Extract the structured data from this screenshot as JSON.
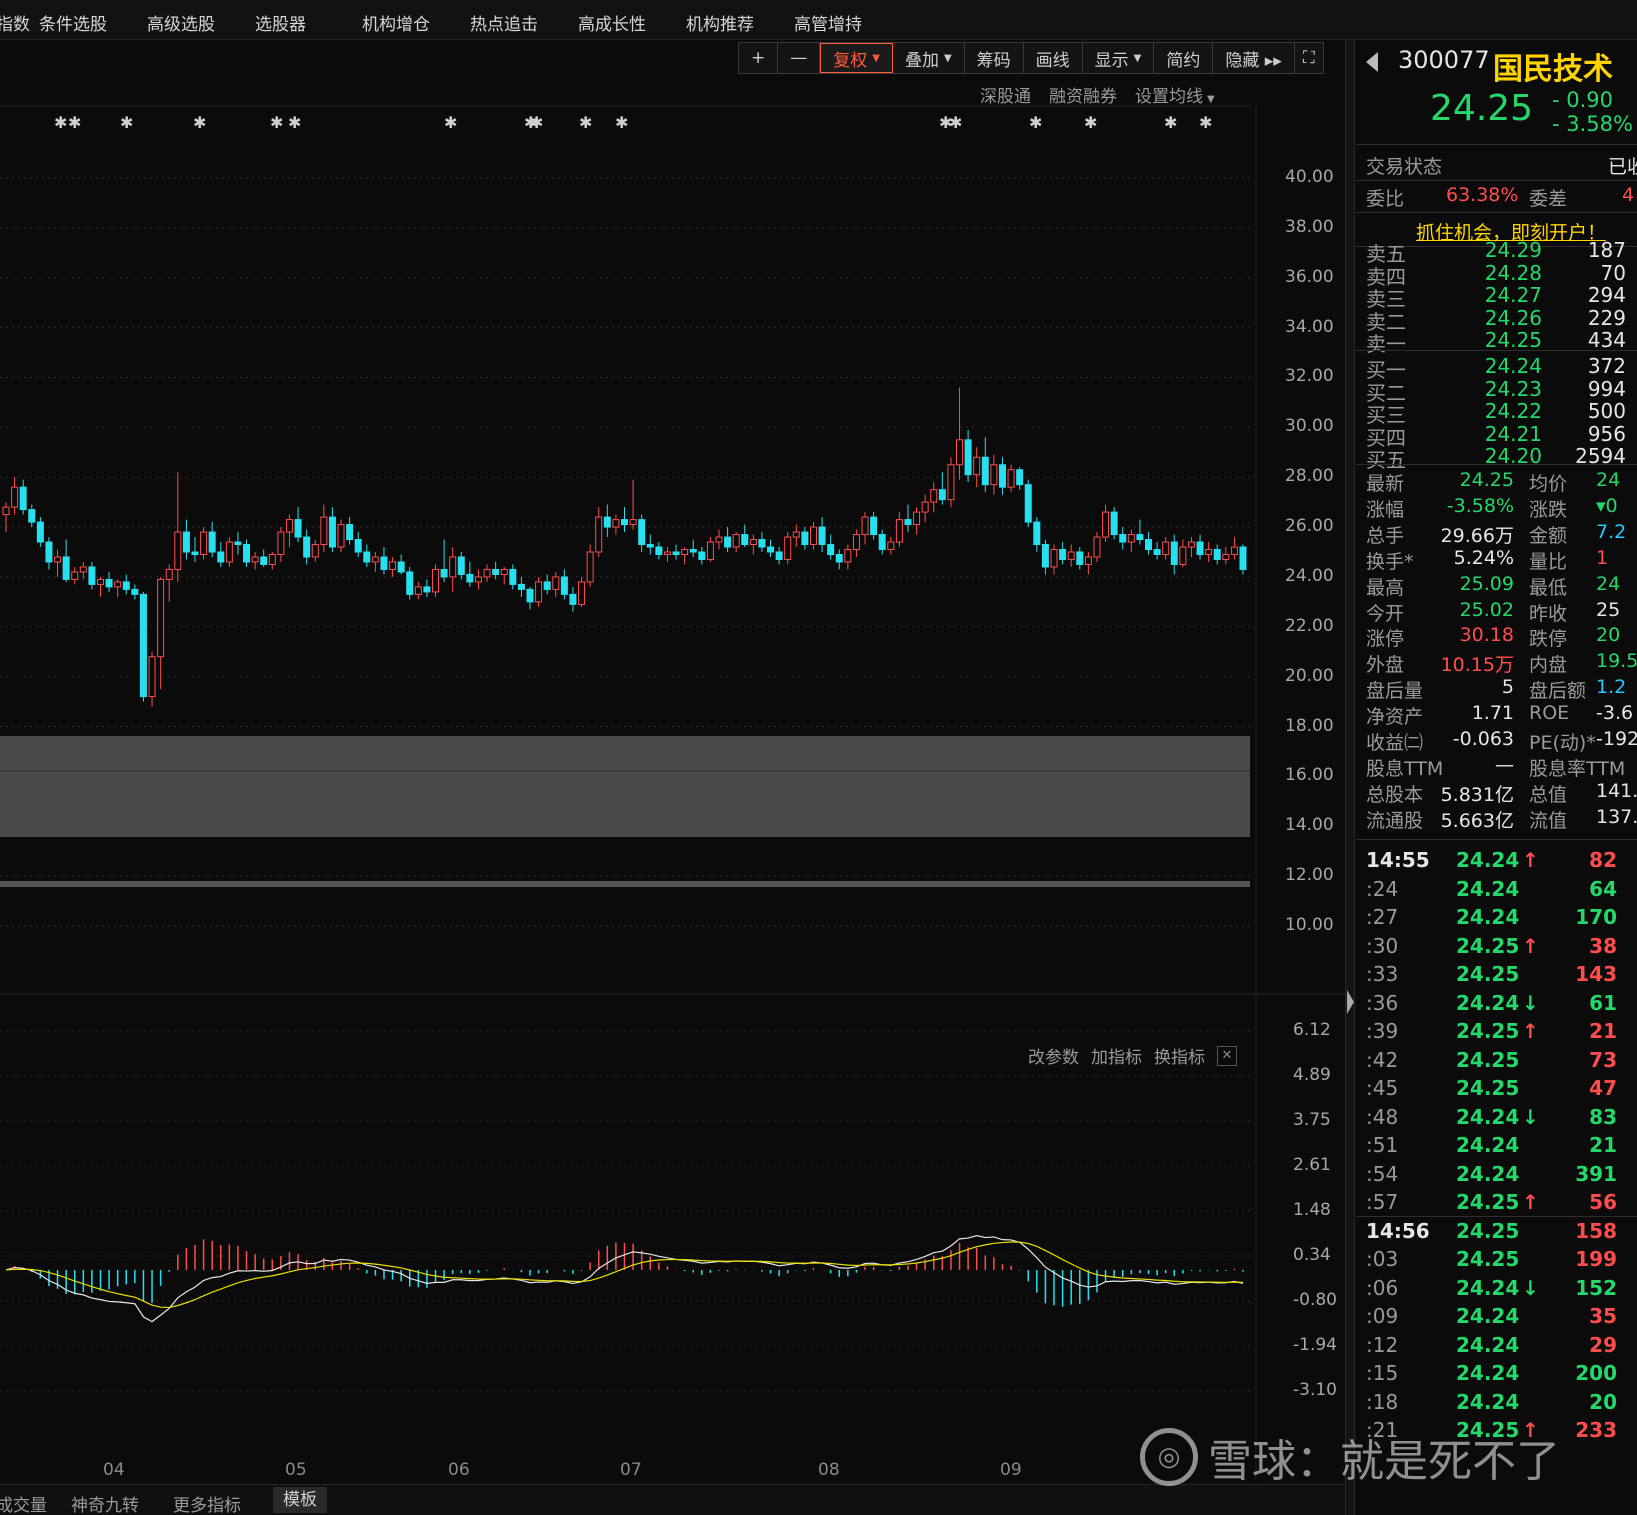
{
  "menu": [
    "指数",
    "条件选股",
    "高级选股",
    "选股器",
    "机构增仓",
    "热点追击",
    "高成长性",
    "机构推荐",
    "高管增持"
  ],
  "toolbar": {
    "plus": "+",
    "minus": "—",
    "fuquan": "复权",
    "diejia": "叠加",
    "chouma": "筹码",
    "huaxian": "画线",
    "xianshi": "显示",
    "jianyue": "简约",
    "yincang": "隐藏 ▸▸",
    "fullscreen": "⛶"
  },
  "sub_toolbar": [
    "深股通",
    "融资融券",
    "设置均线"
  ],
  "indicator_toolbar": [
    "改参数",
    "加指标",
    "换指标"
  ],
  "indicator_close": "✕",
  "bottom_tabs": [
    "成交量",
    "神奇九转",
    "更多指标",
    "模板"
  ],
  "stock": {
    "code": "300077",
    "name": "国民技术",
    "price": "24.25",
    "change": "- 0.90",
    "change_pct": "- 3.58%"
  },
  "status": {
    "label": "交易状态",
    "value": "已收"
  },
  "weibi": {
    "label": "委比",
    "value": "63.38%",
    "label2": "委差",
    "value2": "4"
  },
  "promo": "抓住机会，即刻开户！",
  "asks": [
    {
      "label": "卖五",
      "price": "24.29",
      "vol": "187"
    },
    {
      "label": "卖四",
      "price": "24.28",
      "vol": "70"
    },
    {
      "label": "卖三",
      "price": "24.27",
      "vol": "294"
    },
    {
      "label": "卖二",
      "price": "24.26",
      "vol": "229"
    },
    {
      "label": "卖一",
      "price": "24.25",
      "vol": "434"
    }
  ],
  "bids": [
    {
      "label": "买一",
      "price": "24.24",
      "vol": "372"
    },
    {
      "label": "买二",
      "price": "24.23",
      "vol": "994"
    },
    {
      "label": "买三",
      "price": "24.22",
      "vol": "500"
    },
    {
      "label": "买四",
      "price": "24.21",
      "vol": "956"
    },
    {
      "label": "买五",
      "price": "24.20",
      "vol": "2594"
    }
  ],
  "quote": [
    {
      "k1": "最新",
      "v1": "24.25",
      "c1": "g",
      "k2": "均价",
      "v2": "24",
      "c2": "g"
    },
    {
      "k1": "涨幅",
      "v1": "-3.58%",
      "c1": "g",
      "k2": "涨跌",
      "v2": "▾0",
      "c2": "g"
    },
    {
      "k1": "总手",
      "v1": "29.66万",
      "c1": "w",
      "k2": "金额",
      "v2": "7.2",
      "c2": "c"
    },
    {
      "k1": "换手*",
      "v1": "5.24%",
      "c1": "w",
      "k2": "量比",
      "v2": "1",
      "c2": "r"
    },
    {
      "k1": "最高",
      "v1": "25.09",
      "c1": "g",
      "k2": "最低",
      "v2": "24",
      "c2": "g"
    },
    {
      "k1": "今开",
      "v1": "25.02",
      "c1": "g",
      "k2": "昨收",
      "v2": "25",
      "c2": "w"
    },
    {
      "k1": "涨停",
      "v1": "30.18",
      "c1": "r",
      "k2": "跌停",
      "v2": "20",
      "c2": "g"
    },
    {
      "k1": "外盘",
      "v1": "10.15万",
      "c1": "r",
      "k2": "内盘",
      "v2": "19.5",
      "c2": "g"
    },
    {
      "k1": "盘后量",
      "v1": "5",
      "c1": "w",
      "k2": "盘后额",
      "v2": "1.2",
      "c2": "c"
    },
    {
      "k1": "净资产",
      "v1": "1.71",
      "c1": "w",
      "k2": "ROE",
      "v2": "-3.6",
      "c2": "w"
    },
    {
      "k1": "收益㈡",
      "v1": "-0.063",
      "c1": "w",
      "k2": "PE(动)*",
      "v2": "-192",
      "c2": "w"
    },
    {
      "k1": "股息TTM",
      "v1": "—",
      "c1": "w",
      "k2": "股息率TTM",
      "v2": "",
      "c2": "w"
    },
    {
      "k1": "总股本",
      "v1": "5.831亿",
      "c1": "w",
      "k2": "总值",
      "v2": "141.",
      "c2": "w"
    },
    {
      "k1": "流通股",
      "v1": "5.663亿",
      "c1": "w",
      "k2": "流值",
      "v2": "137.",
      "c2": "w"
    }
  ],
  "ticks": [
    {
      "t": "14:55",
      "p": "24.24",
      "a": "↑",
      "v": "82",
      "vc": "r",
      "b": true
    },
    {
      "t": ":24",
      "p": "24.24",
      "a": "",
      "v": "64",
      "vc": "g"
    },
    {
      "t": ":27",
      "p": "24.24",
      "a": "",
      "v": "170",
      "vc": "g"
    },
    {
      "t": ":30",
      "p": "24.25",
      "a": "↑",
      "v": "38",
      "vc": "r"
    },
    {
      "t": ":33",
      "p": "24.25",
      "a": "",
      "v": "143",
      "vc": "r"
    },
    {
      "t": ":36",
      "p": "24.24",
      "a": "↓",
      "v": "61",
      "vc": "g"
    },
    {
      "t": ":39",
      "p": "24.25",
      "a": "↑",
      "v": "21",
      "vc": "r"
    },
    {
      "t": ":42",
      "p": "24.25",
      "a": "",
      "v": "73",
      "vc": "r"
    },
    {
      "t": ":45",
      "p": "24.25",
      "a": "",
      "v": "47",
      "vc": "r"
    },
    {
      "t": ":48",
      "p": "24.24",
      "a": "↓",
      "v": "83",
      "vc": "g"
    },
    {
      "t": ":51",
      "p": "24.24",
      "a": "",
      "v": "21",
      "vc": "g"
    },
    {
      "t": ":54",
      "p": "24.24",
      "a": "",
      "v": "391",
      "vc": "g"
    },
    {
      "t": ":57",
      "p": "24.25",
      "a": "↑",
      "v": "56",
      "vc": "r"
    },
    {
      "t": "14:56",
      "p": "24.25",
      "a": "",
      "v": "158",
      "vc": "r",
      "b": true
    },
    {
      "t": ":03",
      "p": "24.25",
      "a": "",
      "v": "199",
      "vc": "r"
    },
    {
      "t": ":06",
      "p": "24.24",
      "a": "↓",
      "v": "152",
      "vc": "g"
    },
    {
      "t": ":09",
      "p": "24.24",
      "a": "",
      "v": "35",
      "vc": "r"
    },
    {
      "t": ":12",
      "p": "24.24",
      "a": "",
      "v": "29",
      "vc": "r"
    },
    {
      "t": ":15",
      "p": "24.24",
      "a": "",
      "v": "200",
      "vc": "g"
    },
    {
      "t": ":18",
      "p": "24.24",
      "a": "",
      "v": "20",
      "vc": "g"
    },
    {
      "t": ":21",
      "p": "24.25",
      "a": "↑",
      "v": "233",
      "vc": "r"
    }
  ],
  "price_axis": [
    "40.00",
    "38.00",
    "36.00",
    "34.00",
    "32.00",
    "30.00",
    "28.00",
    "26.00",
    "24.00",
    "22.00",
    "20.00",
    "18.00",
    "16.00",
    "14.00",
    "12.00",
    "10.00"
  ],
  "macd_axis": [
    "6.12",
    "4.89",
    "3.75",
    "2.61",
    "1.48",
    "0.34",
    "-0.80",
    "-1.94",
    "-3.10"
  ],
  "month_labels": [
    "04",
    "05",
    "06",
    "07",
    "08",
    "09"
  ],
  "watermark": {
    "logo": "◎",
    "text": "雪球：就是死不了"
  },
  "colors": {
    "up": "#ff4d4d",
    "down": "#27e0ef",
    "dif": "#e6e6e6",
    "dea": "#e8e000",
    "accent": "#ff5a3c"
  },
  "chart_data": {
    "type": "candlestick",
    "ylim": [
      9,
      42
    ],
    "macd_ylim": [
      -3.1,
      6.12
    ],
    "candles": [
      [
        26.5,
        27.0,
        25.8,
        26.8
      ],
      [
        26.8,
        28.0,
        26.5,
        27.6
      ],
      [
        27.6,
        27.9,
        26.5,
        26.7
      ],
      [
        26.7,
        26.9,
        26.0,
        26.2
      ],
      [
        26.2,
        26.4,
        25.2,
        25.4
      ],
      [
        25.4,
        25.6,
        24.3,
        24.6
      ],
      [
        24.6,
        25.1,
        24.0,
        24.8
      ],
      [
        24.8,
        25.5,
        23.8,
        23.9
      ],
      [
        23.9,
        24.4,
        23.7,
        24.2
      ],
      [
        24.2,
        24.6,
        23.9,
        24.4
      ],
      [
        24.4,
        24.6,
        23.5,
        23.7
      ],
      [
        23.7,
        24.0,
        23.2,
        23.9
      ],
      [
        23.9,
        24.2,
        23.4,
        23.6
      ],
      [
        23.6,
        23.9,
        23.2,
        23.8
      ],
      [
        23.8,
        24.1,
        23.3,
        23.5
      ],
      [
        23.5,
        23.7,
        23.1,
        23.3
      ],
      [
        23.3,
        23.4,
        19.0,
        19.2
      ],
      [
        19.2,
        21.0,
        18.8,
        20.8
      ],
      [
        20.8,
        24.0,
        19.5,
        23.9
      ],
      [
        23.9,
        24.5,
        23.0,
        24.3
      ],
      [
        24.3,
        28.2,
        23.8,
        25.8
      ],
      [
        25.8,
        26.3,
        24.7,
        25.0
      ],
      [
        25.0,
        25.6,
        24.6,
        24.9
      ],
      [
        24.9,
        26.0,
        24.7,
        25.8
      ],
      [
        25.8,
        26.2,
        24.8,
        25.0
      ],
      [
        25.0,
        25.4,
        24.4,
        24.6
      ],
      [
        24.6,
        25.6,
        24.4,
        25.4
      ],
      [
        25.4,
        25.8,
        24.9,
        25.3
      ],
      [
        25.3,
        25.5,
        24.4,
        24.6
      ],
      [
        24.6,
        25.0,
        24.3,
        24.8
      ],
      [
        24.8,
        25.1,
        24.4,
        24.5
      ],
      [
        24.5,
        25.0,
        24.3,
        24.9
      ],
      [
        24.9,
        26.0,
        24.6,
        25.8
      ],
      [
        25.8,
        26.5,
        25.2,
        26.3
      ],
      [
        26.3,
        26.8,
        25.4,
        25.6
      ],
      [
        25.6,
        25.9,
        24.5,
        24.8
      ],
      [
        24.8,
        25.5,
        24.6,
        25.3
      ],
      [
        25.3,
        26.9,
        25.0,
        26.4
      ],
      [
        26.4,
        26.8,
        25.0,
        25.2
      ],
      [
        25.2,
        26.3,
        25.0,
        26.1
      ],
      [
        26.1,
        26.4,
        25.3,
        25.5
      ],
      [
        25.5,
        25.8,
        24.8,
        25.0
      ],
      [
        25.0,
        25.3,
        24.4,
        24.6
      ],
      [
        24.6,
        25.0,
        24.2,
        24.8
      ],
      [
        24.8,
        25.2,
        24.1,
        24.3
      ],
      [
        24.3,
        24.8,
        24.0,
        24.6
      ],
      [
        24.6,
        24.9,
        24.1,
        24.2
      ],
      [
        24.2,
        24.4,
        23.1,
        23.3
      ],
      [
        23.3,
        23.8,
        23.1,
        23.6
      ],
      [
        23.6,
        23.9,
        23.2,
        23.4
      ],
      [
        23.4,
        24.5,
        23.2,
        24.3
      ],
      [
        24.3,
        25.5,
        23.8,
        24.0
      ],
      [
        24.0,
        25.2,
        23.4,
        24.8
      ],
      [
        24.8,
        25.0,
        23.9,
        24.1
      ],
      [
        24.1,
        24.6,
        23.6,
        23.8
      ],
      [
        23.8,
        24.3,
        23.5,
        24.0
      ],
      [
        24.0,
        24.5,
        23.8,
        24.3
      ],
      [
        24.3,
        24.6,
        23.9,
        24.1
      ],
      [
        24.1,
        24.4,
        23.7,
        24.3
      ],
      [
        24.3,
        24.5,
        23.5,
        23.7
      ],
      [
        23.7,
        24.0,
        23.2,
        23.5
      ],
      [
        23.5,
        23.6,
        22.7,
        23.0
      ],
      [
        23.0,
        24.0,
        22.8,
        23.8
      ],
      [
        23.8,
        24.1,
        23.3,
        23.5
      ],
      [
        23.5,
        24.2,
        23.2,
        24.0
      ],
      [
        24.0,
        24.3,
        23.1,
        23.3
      ],
      [
        23.3,
        23.6,
        22.6,
        22.9
      ],
      [
        22.9,
        24.0,
        22.8,
        23.8
      ],
      [
        23.8,
        25.3,
        23.6,
        25.0
      ],
      [
        25.0,
        26.8,
        24.8,
        26.4
      ],
      [
        26.4,
        26.9,
        25.6,
        26.0
      ],
      [
        26.0,
        26.5,
        25.7,
        26.3
      ],
      [
        26.3,
        26.8,
        25.8,
        26.1
      ],
      [
        26.1,
        27.9,
        25.9,
        26.3
      ],
      [
        26.3,
        26.5,
        25.0,
        25.3
      ],
      [
        25.3,
        25.7,
        24.9,
        25.2
      ],
      [
        25.2,
        25.4,
        24.7,
        24.9
      ],
      [
        24.9,
        25.2,
        24.6,
        25.0
      ],
      [
        25.0,
        25.3,
        24.7,
        24.9
      ],
      [
        24.9,
        25.2,
        24.5,
        25.1
      ],
      [
        25.1,
        25.5,
        24.8,
        25.0
      ],
      [
        25.0,
        25.2,
        24.5,
        24.7
      ],
      [
        24.7,
        25.6,
        24.6,
        25.4
      ],
      [
        25.4,
        25.9,
        25.1,
        25.6
      ],
      [
        25.6,
        26.0,
        25.0,
        25.2
      ],
      [
        25.2,
        25.8,
        25.0,
        25.7
      ],
      [
        25.7,
        26.1,
        25.2,
        25.3
      ],
      [
        25.3,
        25.7,
        24.9,
        25.5
      ],
      [
        25.5,
        25.8,
        25.0,
        25.2
      ],
      [
        25.2,
        25.5,
        24.8,
        25.0
      ],
      [
        25.0,
        25.2,
        24.5,
        24.7
      ],
      [
        24.7,
        25.8,
        24.5,
        25.6
      ],
      [
        25.6,
        26.1,
        25.2,
        25.8
      ],
      [
        25.8,
        26.0,
        25.1,
        25.3
      ],
      [
        25.3,
        26.2,
        25.1,
        26.0
      ],
      [
        26.0,
        26.4,
        25.0,
        25.3
      ],
      [
        25.3,
        25.7,
        24.7,
        24.9
      ],
      [
        24.9,
        25.1,
        24.3,
        24.6
      ],
      [
        24.6,
        25.3,
        24.3,
        25.1
      ],
      [
        25.1,
        25.9,
        24.8,
        25.7
      ],
      [
        25.7,
        26.6,
        25.3,
        26.4
      ],
      [
        26.4,
        26.6,
        25.5,
        25.7
      ],
      [
        25.7,
        25.9,
        24.9,
        25.1
      ],
      [
        25.1,
        25.6,
        24.9,
        25.4
      ],
      [
        25.4,
        26.6,
        25.2,
        26.3
      ],
      [
        26.3,
        26.9,
        25.8,
        26.1
      ],
      [
        26.1,
        26.8,
        25.7,
        26.6
      ],
      [
        26.6,
        27.3,
        26.2,
        27.0
      ],
      [
        27.0,
        27.8,
        26.6,
        27.5
      ],
      [
        27.5,
        28.2,
        26.9,
        27.1
      ],
      [
        27.1,
        28.8,
        26.8,
        28.5
      ],
      [
        28.5,
        31.6,
        27.9,
        29.5
      ],
      [
        29.5,
        29.9,
        27.8,
        28.1
      ],
      [
        28.1,
        29.2,
        27.6,
        28.8
      ],
      [
        28.8,
        29.6,
        27.4,
        27.7
      ],
      [
        27.7,
        28.9,
        27.3,
        28.5
      ],
      [
        28.5,
        28.8,
        27.3,
        27.6
      ],
      [
        27.6,
        28.5,
        27.4,
        28.3
      ],
      [
        28.3,
        28.4,
        27.5,
        27.7
      ],
      [
        27.7,
        27.9,
        26.0,
        26.2
      ],
      [
        26.2,
        26.4,
        25.0,
        25.3
      ],
      [
        25.3,
        25.5,
        24.1,
        24.4
      ],
      [
        24.4,
        25.3,
        24.1,
        25.1
      ],
      [
        25.1,
        25.4,
        24.5,
        24.7
      ],
      [
        24.7,
        25.3,
        24.4,
        25.0
      ],
      [
        25.0,
        25.2,
        24.3,
        24.5
      ],
      [
        24.5,
        25.0,
        24.1,
        24.8
      ],
      [
        24.8,
        25.8,
        24.6,
        25.6
      ],
      [
        25.6,
        26.9,
        25.4,
        26.6
      ],
      [
        26.6,
        26.8,
        25.5,
        25.7
      ],
      [
        25.7,
        26.0,
        25.1,
        25.4
      ],
      [
        25.4,
        25.9,
        25.0,
        25.7
      ],
      [
        25.7,
        26.3,
        25.3,
        25.5
      ],
      [
        25.5,
        25.8,
        24.9,
        25.1
      ],
      [
        25.1,
        25.4,
        24.7,
        24.9
      ],
      [
        24.9,
        25.6,
        24.7,
        25.4
      ],
      [
        25.4,
        25.7,
        24.1,
        24.5
      ],
      [
        24.5,
        25.5,
        24.4,
        25.2
      ],
      [
        25.2,
        25.6,
        24.8,
        25.4
      ],
      [
        25.4,
        25.7,
        24.7,
        24.9
      ],
      [
        24.9,
        25.4,
        24.6,
        25.1
      ],
      [
        25.1,
        25.3,
        24.5,
        24.7
      ],
      [
        24.7,
        25.2,
        24.5,
        24.9
      ],
      [
        24.9,
        25.6,
        24.7,
        25.2
      ],
      [
        25.2,
        25.3,
        24.1,
        24.3
      ]
    ]
  }
}
